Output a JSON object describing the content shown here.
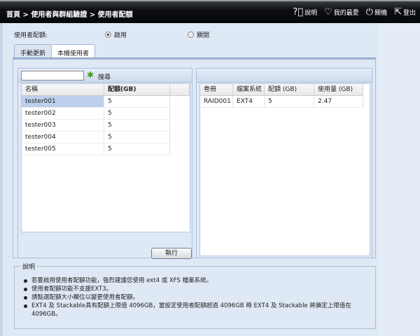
{
  "header": {
    "breadcrumb": "首頁 > 使用者與群組驗證 > 使用者配額",
    "help": "說明",
    "favorites": "我的最愛",
    "shutdown": "關機",
    "logout": "登出"
  },
  "quota": {
    "label": "使用者配額:",
    "enable": "啟用",
    "disable": "關閉",
    "selected": "enable"
  },
  "tabs": [
    {
      "label": "手動更新"
    },
    {
      "label": "本機使用者",
      "active": true
    }
  ],
  "left": {
    "search_value": "",
    "search_label": "搜尋",
    "columns": [
      "名稱",
      "配額(GB)"
    ],
    "rows": [
      {
        "name": "tester001",
        "quota": "5"
      },
      {
        "name": "tester002",
        "quota": "5"
      },
      {
        "name": "tester003",
        "quota": "5"
      },
      {
        "name": "tester004",
        "quota": "5"
      },
      {
        "name": "tester005",
        "quota": "5"
      }
    ],
    "apply": "執行"
  },
  "right": {
    "columns": [
      "卷冊",
      "檔案系統",
      "配額 (GB)",
      "使用量 (GB)"
    ],
    "rows": [
      {
        "volume": "RAID001",
        "fs": "EXT4",
        "quota": "5",
        "used": "2.47"
      }
    ]
  },
  "description": {
    "title": "說明",
    "items": [
      "若要啟用使用者配額功能，強烈建議您使用 ext4 或 XFS 檔案系統。",
      "使用者配額功能不支援EXT3。",
      "請點選配額大小欄位以變更使用者配額。",
      "EXT4 及 Stackable具有配額上限值 4096GB，當設定使用者配額超過 4096GB 時 EXT4 及 Stackable 將鎖定上限值在 4096GB。"
    ]
  }
}
